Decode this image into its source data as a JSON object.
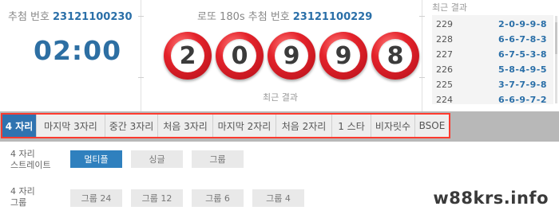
{
  "next_draw": {
    "label": "추첨 번호",
    "round": "23121100230",
    "countdown": "02:00"
  },
  "current_draw": {
    "label": "로또 180s 추첨 번호",
    "round": "23121100229",
    "balls": [
      "2",
      "0",
      "9",
      "9",
      "8"
    ],
    "caption": "최근 결과"
  },
  "recent_results": {
    "title": "최근 결과",
    "rows": [
      {
        "round": "229",
        "digits": "2-0-9-9-8"
      },
      {
        "round": "228",
        "digits": "6-6-7-8-3"
      },
      {
        "round": "227",
        "digits": "6-7-5-3-8"
      },
      {
        "round": "226",
        "digits": "5-8-4-9-5"
      },
      {
        "round": "225",
        "digits": "3-7-7-9-8"
      },
      {
        "round": "224",
        "digits": "6-6-9-7-2"
      }
    ]
  },
  "tabs": [
    "4 자리",
    "마지막 3자리",
    "중간 3자리",
    "처음 3자리",
    "마지막 2자리",
    "처음 2자리",
    "1 스타",
    "비자릿수",
    "BSOE"
  ],
  "bet": {
    "straight": {
      "label_line1": "4 자리",
      "label_line2": "스트레이트",
      "options": [
        "멀티플",
        "싱글",
        "그룹"
      ]
    },
    "group": {
      "label_line1": "4 자리",
      "label_line2": "그룹",
      "options": [
        "그룹 24",
        "그룹 12",
        "그룹 6",
        "그룹 4"
      ]
    }
  },
  "watermark": "w88krs.info",
  "colors": {
    "accent": "#2f73b0",
    "ball": "#e4232b",
    "highlight_border": "#ff3b2f",
    "digits": "#2a6fa8"
  }
}
